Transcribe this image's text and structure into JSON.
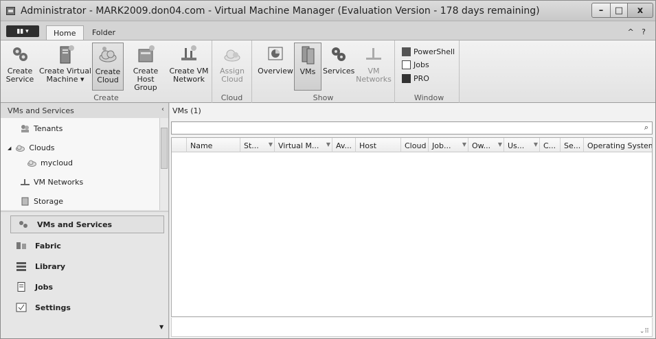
{
  "window": {
    "title": "Administrator - MARK2009.don04.com - Virtual Machine Manager (Evaluation Version - 178 days remaining)",
    "min_glyph": "–",
    "max_glyph": "□",
    "close_glyph": "x"
  },
  "ribbon_tabs": {
    "file_glyph": "▮▮ ▾",
    "home": "Home",
    "folder": "Folder",
    "help_glyphs": "^ ?"
  },
  "ribbon": {
    "create_group": {
      "label": "Create",
      "buttons": [
        {
          "line1": "Create",
          "line2": "Service"
        },
        {
          "line1": "Create Virtual",
          "line2": "Machine ▾"
        },
        {
          "line1": "Create",
          "line2": "Cloud"
        },
        {
          "line1": "Create Host",
          "line2": "Group"
        },
        {
          "line1": "Create VM",
          "line2": "Network"
        }
      ]
    },
    "cloud_group": {
      "label": "Cloud",
      "buttons": [
        {
          "line1": "Assign",
          "line2": "Cloud"
        }
      ]
    },
    "show_group": {
      "label": "Show",
      "buttons": [
        {
          "line1": "Overview",
          "line2": ""
        },
        {
          "line1": "VMs",
          "line2": ""
        },
        {
          "line1": "Services",
          "line2": ""
        },
        {
          "line1": "VM",
          "line2": "Networks"
        }
      ]
    },
    "window_group": {
      "label": "Window",
      "buttons": [
        "PowerShell",
        "Jobs",
        "PRO"
      ]
    }
  },
  "left_pane": {
    "header": "VMs and Services",
    "collapse_glyph": "‹",
    "tree": [
      {
        "label": "Tenants"
      },
      {
        "label": "Clouds",
        "expander": "◢"
      },
      {
        "label": "mycloud"
      },
      {
        "label": "VM Networks"
      },
      {
        "label": "Storage"
      }
    ],
    "nav": [
      {
        "label": "VMs and Services",
        "selected": true
      },
      {
        "label": "Fabric"
      },
      {
        "label": "Library"
      },
      {
        "label": "Jobs"
      },
      {
        "label": "Settings"
      }
    ]
  },
  "main": {
    "header": "VMs (1)",
    "search_placeholder": "",
    "search_glyph": "⌕",
    "columns": [
      "Name",
      "St...",
      "Virtual M...",
      "Av...",
      "Host",
      "Cloud",
      "Job...",
      "Ow...",
      "Us...",
      "C...",
      "Se...",
      "Operating System"
    ],
    "rows": []
  },
  "colors": {
    "titlebar": "#d0d0d0",
    "ribbon": "#eaeaea",
    "pane": "#e6e6e6",
    "selected": "#e1e1e1"
  }
}
